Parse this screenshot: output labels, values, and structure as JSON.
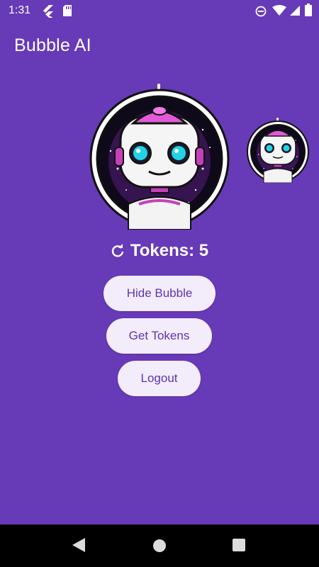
{
  "status_bar": {
    "time": "1:31",
    "icons": [
      "flutter-icon",
      "sd-card-icon",
      "do-not-disturb-icon",
      "wifi-icon",
      "signal-icon",
      "battery-icon"
    ]
  },
  "app_bar": {
    "title": "Bubble AI"
  },
  "tokens": {
    "label": "Tokens: 5"
  },
  "actions": {
    "hide_bubble": "Hide Bubble",
    "get_tokens": "Get Tokens",
    "logout": "Logout"
  },
  "colors": {
    "primary": "#673ab7",
    "button_bg": "#f3ecfb",
    "button_text": "#5e35b1",
    "accent_pink": "#e05ad6",
    "eye_cyan": "#22d3e8"
  },
  "nav_bar": {
    "icons": [
      "back-icon",
      "home-icon",
      "recents-icon"
    ]
  }
}
